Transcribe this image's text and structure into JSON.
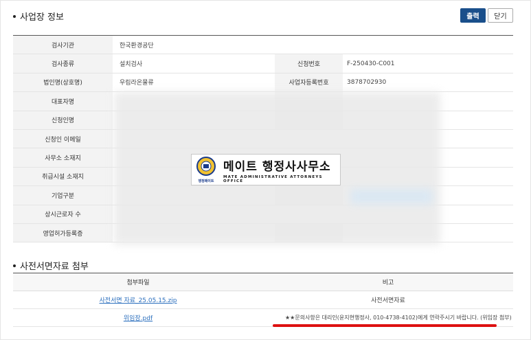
{
  "section1": {
    "title": "사업장 정보"
  },
  "buttons": {
    "print": "출력",
    "close": "닫기"
  },
  "info": {
    "inspection_agency_label": "검사기관",
    "inspection_agency_value": "한국환경공단",
    "inspection_type_label": "검사종류",
    "inspection_type_value": "설치검사",
    "application_no_label": "신청번호",
    "application_no_value": "F-250430-C001",
    "corp_name_label": "법인명(상호명)",
    "corp_name_value": "우림라온물류",
    "biz_reg_no_label": "사업자등록번호",
    "biz_reg_no_value": "3878702930",
    "rep_name_label": "대표자명",
    "applicant_label": "신청인명",
    "applicant_email_label": "신청인 이메일",
    "office_address_label": "사무소 소재지",
    "facility_address_label": "취급시설 소재지",
    "company_type_label": "기업구분",
    "employees_label": "상시근로자 수",
    "business_license_label": "영업허가등록증"
  },
  "watermark": {
    "main": "메이트 행정사사무소",
    "sub": "MATE ADMINISTRATIVE ATTORNEYS OFFICE",
    "seal_text": "행정메이트"
  },
  "section2": {
    "title": "사전서면자료 첨부"
  },
  "files": {
    "col_file": "첨부파일",
    "col_note": "비고",
    "rows": [
      {
        "file": "사전서면 자료_25.05.15.zip",
        "note": "사전서면자료"
      },
      {
        "file": "위임장.pdf",
        "note": "★★문의사항은 대리인(윤지현행정사, 010-4738-4102)에게 연락주시기 바랍니다. (위임장 첨부)"
      }
    ]
  },
  "colors": {
    "primary": "#1a4f8b",
    "link": "#2a6ebd",
    "highlight": "#dd1111"
  }
}
